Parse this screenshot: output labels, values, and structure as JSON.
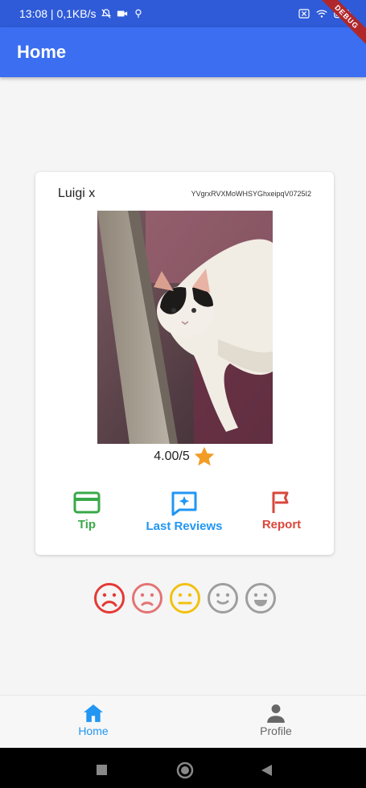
{
  "status_bar": {
    "time_speed": "13:08 | 0,1KB/s"
  },
  "app_bar": {
    "title": "Home",
    "debug_banner": "DEBUG"
  },
  "card": {
    "name": "Luigi x",
    "user_id": "YVgrxRVXMoWHSYGhxeipqV0725I2",
    "rating_text": "4.00/5",
    "actions": [
      {
        "label": "Tip",
        "color": "#3aa84a"
      },
      {
        "label": "Last Reviews",
        "color": "#2196f3"
      },
      {
        "label": "Report",
        "color": "#d9473b"
      }
    ]
  },
  "faces": [
    {
      "name": "very-dissatisfied",
      "color": "#e53935"
    },
    {
      "name": "dissatisfied",
      "color": "#e57373"
    },
    {
      "name": "neutral",
      "color": "#f2c10f"
    },
    {
      "name": "satisfied",
      "color": "#9e9e9e"
    },
    {
      "name": "very-satisfied",
      "color": "#9e9e9e"
    }
  ],
  "bottom_nav": {
    "home_label": "Home",
    "profile_label": "Profile",
    "active_color": "#2196f3",
    "inactive_color": "#666666"
  }
}
